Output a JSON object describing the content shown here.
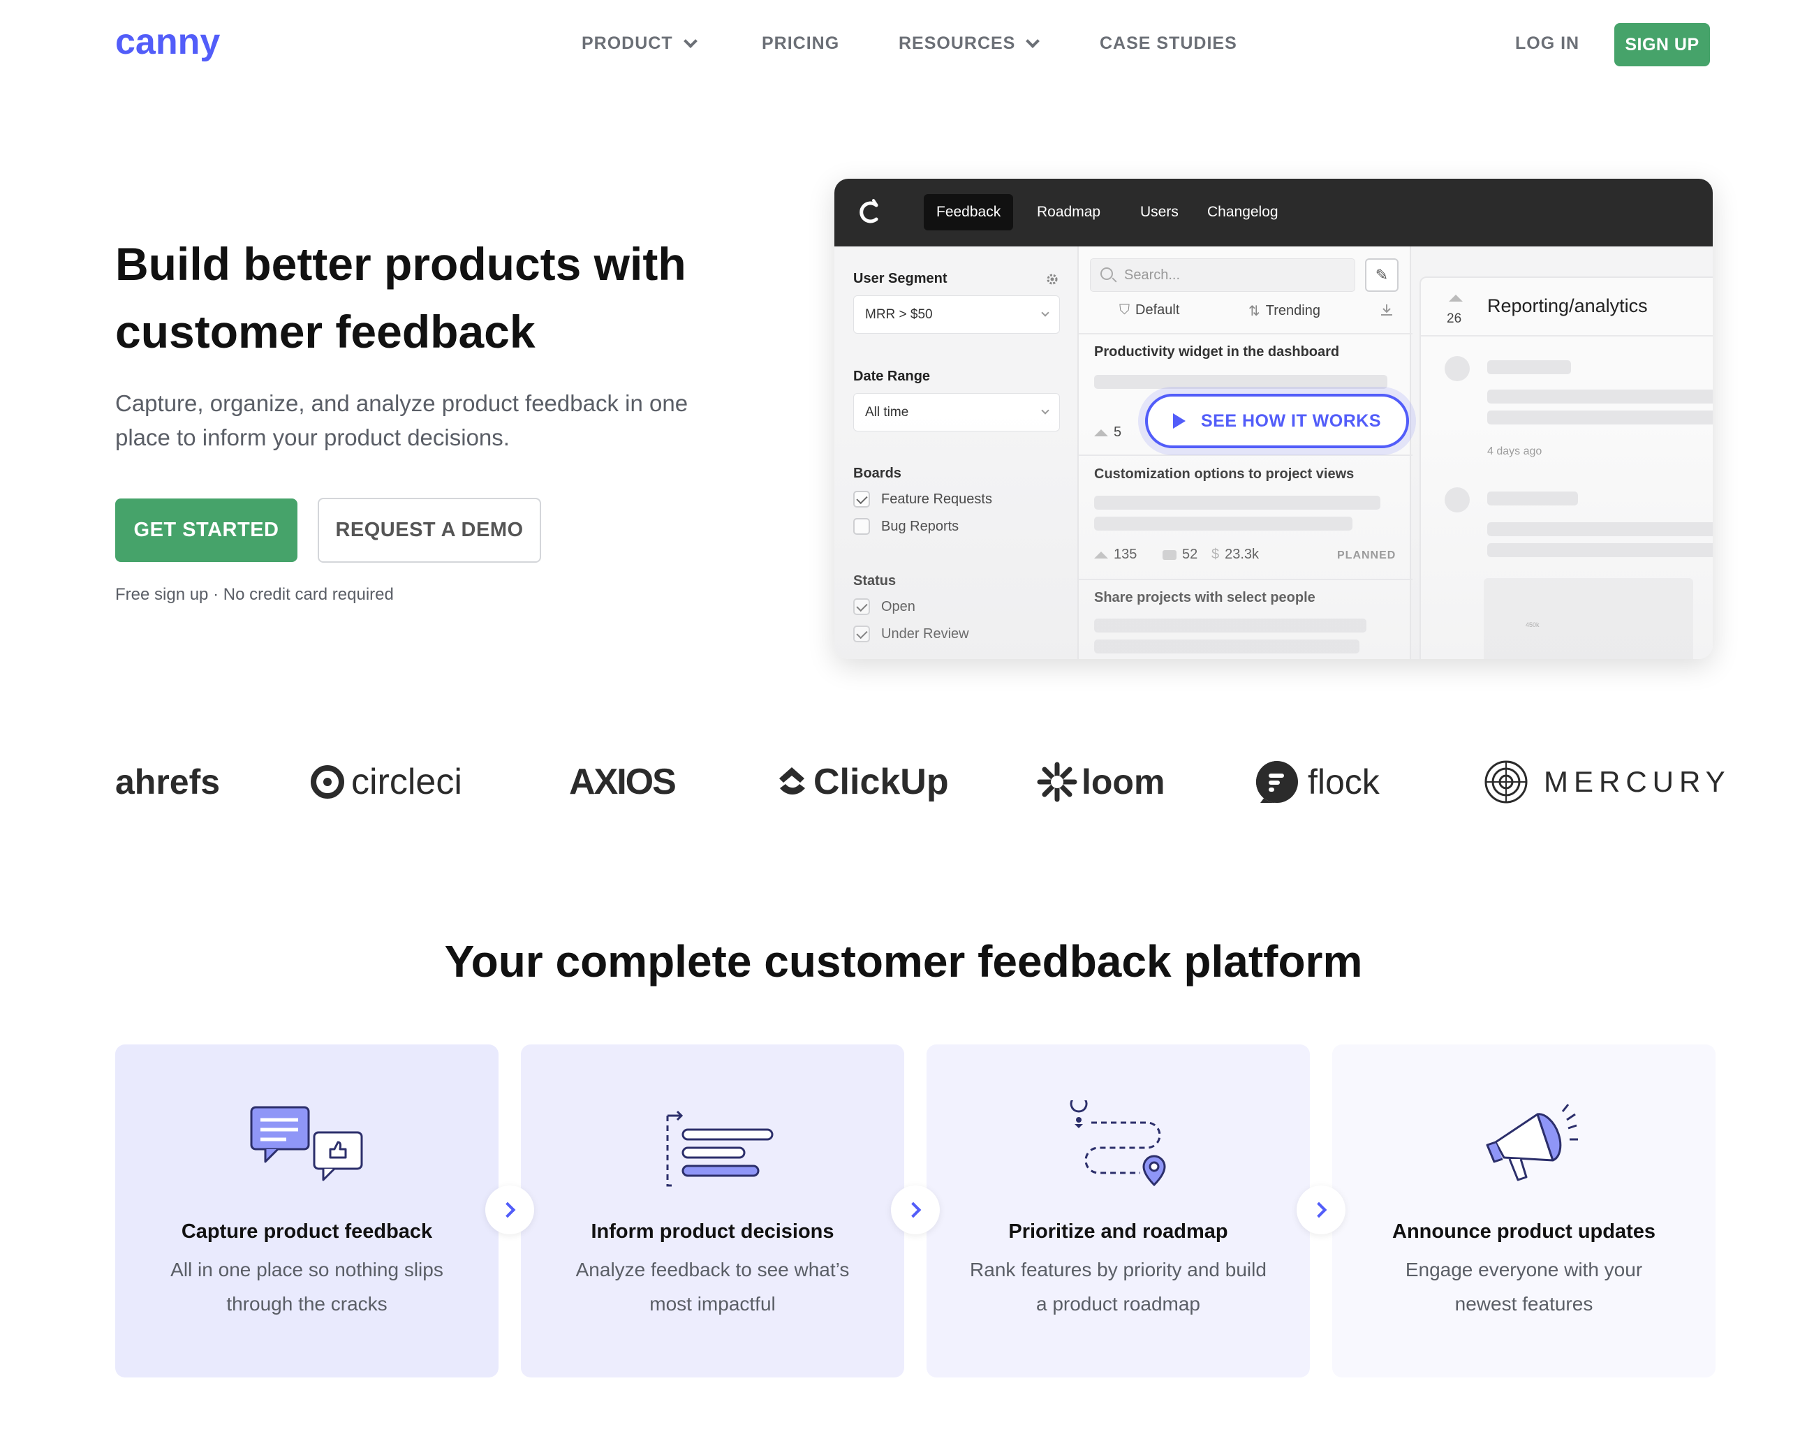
{
  "nav": {
    "logo": "canny",
    "links": [
      {
        "label": "PRODUCT",
        "dropdown": true
      },
      {
        "label": "PRICING",
        "dropdown": false
      },
      {
        "label": "RESOURCES",
        "dropdown": true
      },
      {
        "label": "CASE STUDIES",
        "dropdown": false
      }
    ],
    "login": "LOG IN",
    "signup": "SIGN UP"
  },
  "hero": {
    "title": "Build better products with customer feedback",
    "subtitle": "Capture, organize, and analyze product feedback in one place to inform your product decisions.",
    "get_started": "GET STARTED",
    "request_demo": "REQUEST A DEMO",
    "fine_print": "Free sign up · No credit card required"
  },
  "mock": {
    "tabs": [
      "Feedback",
      "Roadmap",
      "Users",
      "Changelog"
    ],
    "sidebar": {
      "segment_label": "User Segment",
      "segment_value": "MRR > $50",
      "date_label": "Date Range",
      "date_value": "All time",
      "boards_label": "Boards",
      "boards": [
        {
          "label": "Feature Requests",
          "checked": true
        },
        {
          "label": "Bug Reports",
          "checked": false
        }
      ],
      "status_label": "Status",
      "statuses": [
        {
          "label": "Open",
          "checked": true
        },
        {
          "label": "Under Review",
          "checked": true
        }
      ]
    },
    "list": {
      "search_placeholder": "Search...",
      "sort_default": "Default",
      "sort_trending": "Trending",
      "posts": [
        {
          "title": "Productivity widget in the dashboard",
          "votes": "5"
        },
        {
          "title": "Customization options to project views",
          "votes": "135",
          "comments": "52",
          "revenue": "23.3k",
          "status": "PLANNED"
        },
        {
          "title": "Share projects with select people"
        }
      ]
    },
    "detail": {
      "votes": "26",
      "title": "Reporting/analytics",
      "time": "4 days ago",
      "chart_label": "450k"
    },
    "see_how": "SEE HOW IT WORKS"
  },
  "logos": [
    "ahrefs",
    "circleci",
    "AXIOS",
    "ClickUp",
    "loom",
    "flock",
    "MERCURY"
  ],
  "platform": {
    "title": "Your complete customer feedback platform",
    "cards": [
      {
        "title": "Capture product feedback",
        "desc": "All in one place so nothing slips through the cracks",
        "bg": "#e9eafd"
      },
      {
        "title": "Inform product decisions",
        "desc": "Analyze feedback to see what’s most impactful",
        "bg": "#ededfd"
      },
      {
        "title": "Prioritize and roadmap",
        "desc": "Rank features by priority and build a product roadmap",
        "bg": "#f2f2fe"
      },
      {
        "title": "Announce product updates",
        "desc": "Engage everyone with your newest features",
        "bg": "#f8f8fe"
      }
    ]
  },
  "colors": {
    "brand": "#525df9",
    "green": "#46a36a"
  }
}
